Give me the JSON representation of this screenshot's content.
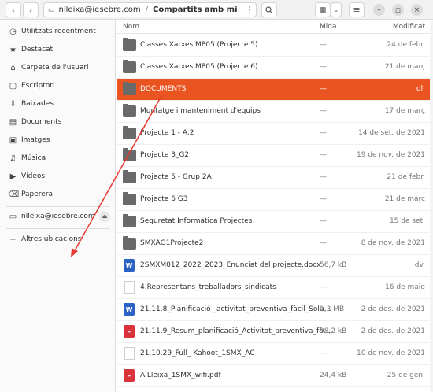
{
  "headerbar": {
    "back_icon": "chevron-left",
    "forward_icon": "chevron-right",
    "path": [
      "nlleixa@iesebre.com",
      "Compartits amb mi"
    ],
    "path_separator": "/"
  },
  "sidebar": {
    "items": [
      {
        "label": "Utilitzats recentment",
        "icon": "clock"
      },
      {
        "label": "Destacat",
        "icon": "star"
      },
      {
        "label": "Carpeta de l'usuari",
        "icon": "home"
      },
      {
        "label": "Escriptori",
        "icon": "desktop"
      },
      {
        "label": "Baixades",
        "icon": "download"
      },
      {
        "label": "Documents",
        "icon": "document"
      },
      {
        "label": "Imatges",
        "icon": "image"
      },
      {
        "label": "Música",
        "icon": "music"
      },
      {
        "label": "Vídeos",
        "icon": "video"
      },
      {
        "label": "Paperera",
        "icon": "trash"
      }
    ],
    "account": {
      "label": "nlleixa@iesebre.com",
      "icon": "drive"
    },
    "other_locations": {
      "label": "Altres ubicacions",
      "icon": "plus"
    }
  },
  "columns": {
    "name": "Nom",
    "size": "Mida",
    "modified": "Modificat"
  },
  "files": [
    {
      "name": "Classes Xarxes MP05 (Projecte 5)",
      "size": "—",
      "modified": "24 de febr.",
      "type": "folder"
    },
    {
      "name": "Classes Xarxes MP05 (Projecte 6)",
      "size": "—",
      "modified": "21 de març",
      "type": "folder"
    },
    {
      "name": "DOCUMENTS",
      "size": "—",
      "modified": "dl.",
      "type": "folder",
      "selected": true
    },
    {
      "name": "Muntatge i manteniment d'equips",
      "size": "—",
      "modified": "17 de març",
      "type": "folder"
    },
    {
      "name": "Projecte 1 - A.2",
      "size": "—",
      "modified": "14 de set. de 2021",
      "type": "folder"
    },
    {
      "name": "Projecte 3_G2",
      "size": "—",
      "modified": "19 de nov. de 2021",
      "type": "folder"
    },
    {
      "name": "Projecte 5 - Grup 2A",
      "size": "—",
      "modified": "21 de febr.",
      "type": "folder"
    },
    {
      "name": "Projecte 6 G3",
      "size": "—",
      "modified": "21 de març",
      "type": "folder"
    },
    {
      "name": "Seguretat Informàtica Projectes",
      "size": "—",
      "modified": "15 de set.",
      "type": "folder"
    },
    {
      "name": "SMXAG1Projecte2",
      "size": "—",
      "modified": "8 de nov. de 2021",
      "type": "folder"
    },
    {
      "name": "2SMXM012_2022_2023_Enunciat del projecte.docx",
      "size": "56,7 kB",
      "modified": "dv.",
      "type": "word"
    },
    {
      "name": "4.Representans_treballadors_sindicats",
      "size": "—",
      "modified": "16 de maig",
      "type": "doc"
    },
    {
      "name": "21.11.8_Planificació _activitat_preventiva_fàcil_Solu…",
      "size": "1,3 MB",
      "modified": "2 de des. de 2021",
      "type": "word"
    },
    {
      "name": "21.11.9_Resum_planificació_Activitat_preventiva_fà…",
      "size": "98,2 kB",
      "modified": "2 de des. de 2021",
      "type": "pdf"
    },
    {
      "name": "21.10.29_Full_ Kahoot_1SMX_AC",
      "size": "—",
      "modified": "10 de nov. de 2021",
      "type": "doc"
    },
    {
      "name": "A.Lleixa_1SMX_wifi.pdf",
      "size": "24,4 kB",
      "modified": "25 de gen.",
      "type": "pdf"
    }
  ],
  "colors": {
    "accent": "#e95420",
    "annotation_arrow": "#e8382f"
  }
}
